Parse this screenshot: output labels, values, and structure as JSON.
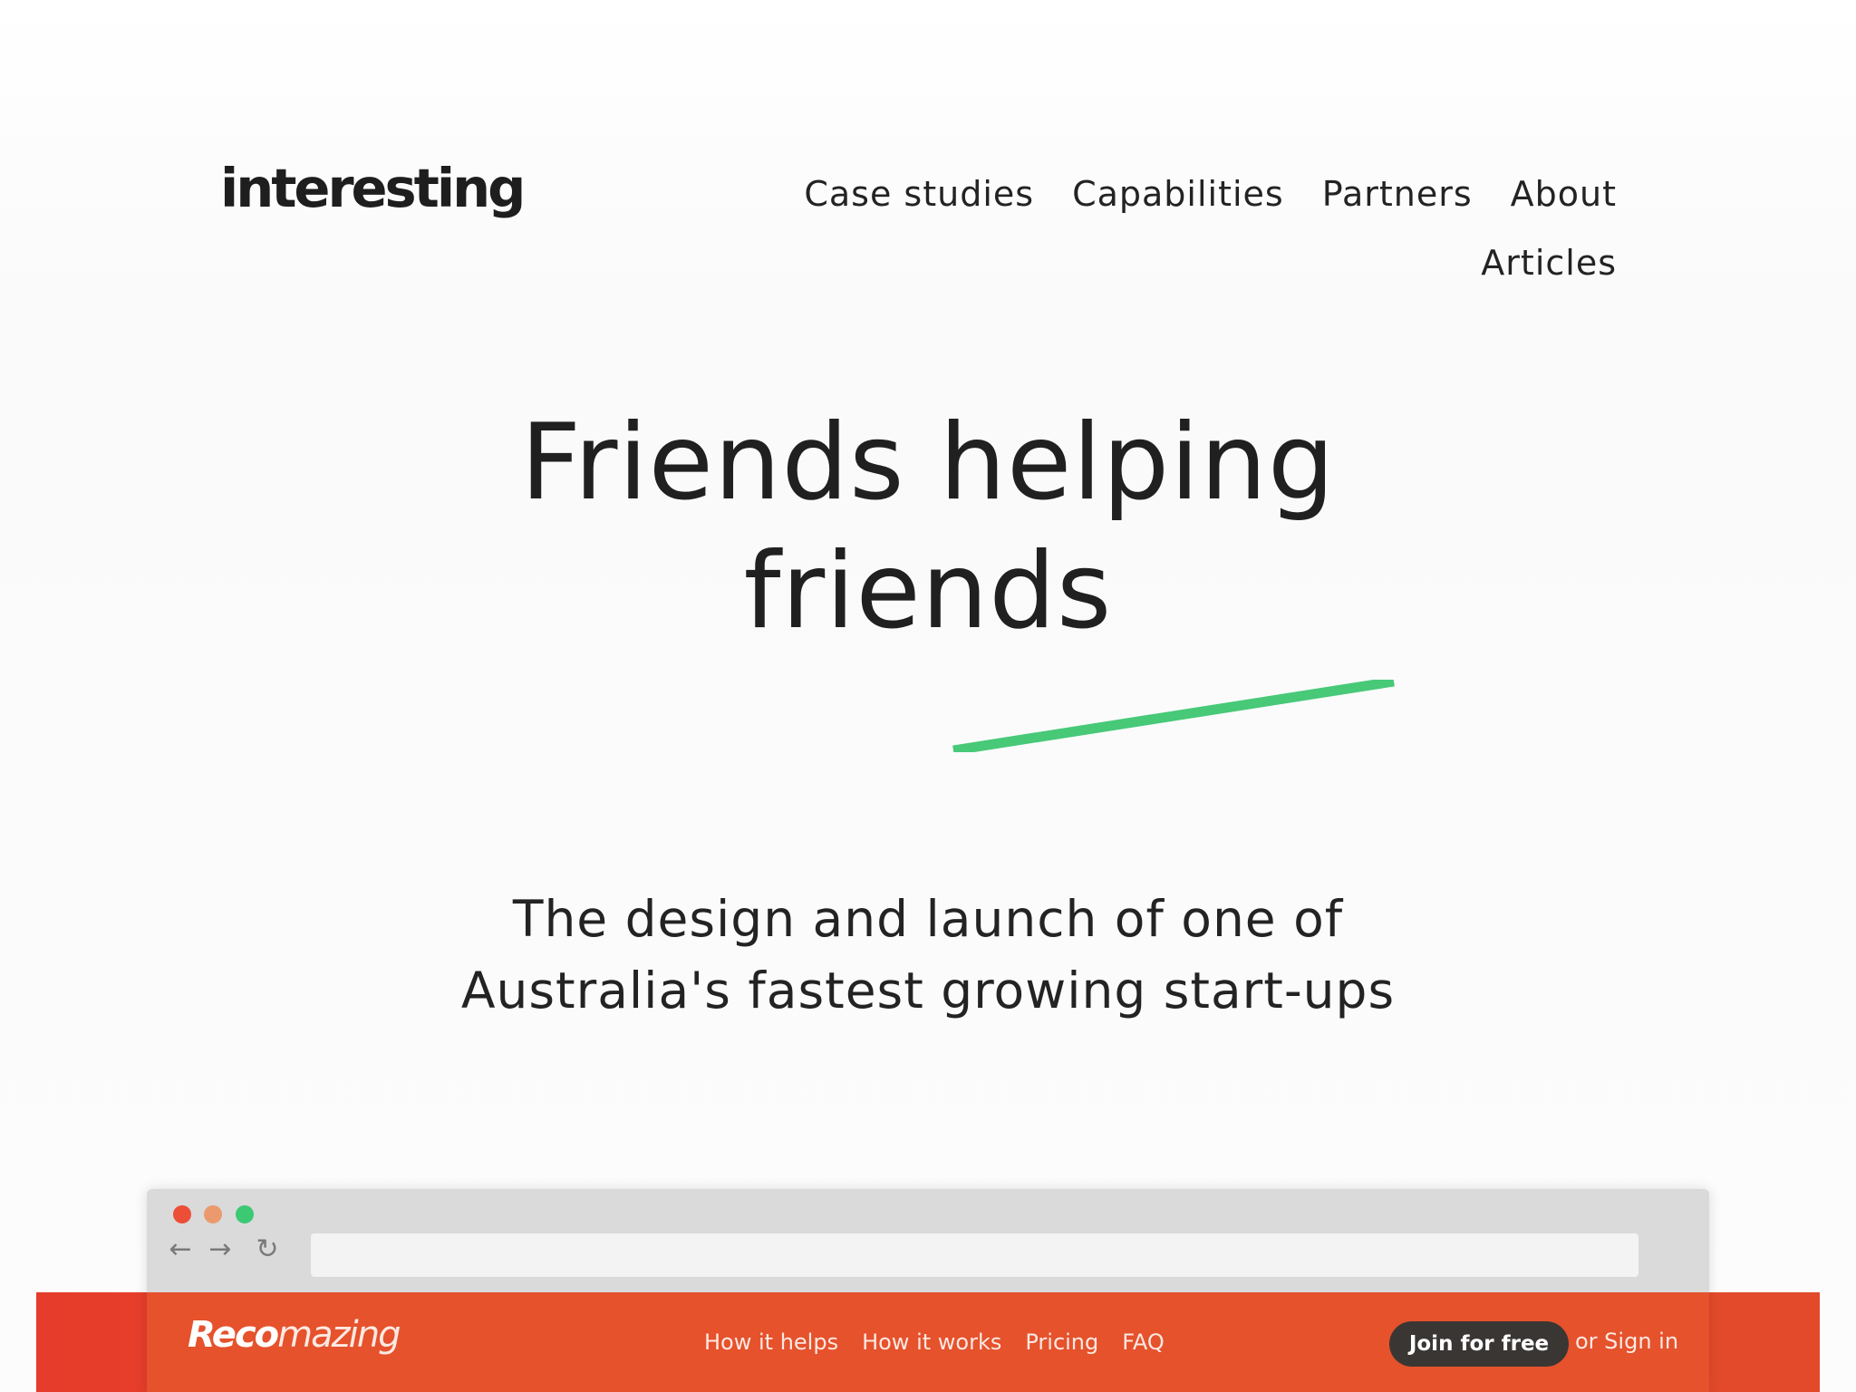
{
  "header": {
    "logo_text": "interesting",
    "nav": [
      {
        "label": "Case studies"
      },
      {
        "label": "Capabilities"
      },
      {
        "label": "Partners"
      },
      {
        "label": "About"
      },
      {
        "label": "Articles"
      }
    ]
  },
  "hero": {
    "title_line1": "Friends helping",
    "title_line2": "friends",
    "subtitle_line1": "The design and launch of one of",
    "subtitle_line2": "Australia's fastest growing start-ups",
    "accent_color": "#47c978"
  },
  "browser_mockup": {
    "window_dots": [
      "close-dot",
      "minimize-dot",
      "maximize-dot"
    ],
    "dot_colors": [
      "#ec4e37",
      "#eb9a6e",
      "#3dc873"
    ],
    "back_icon": "←",
    "forward_icon": "→",
    "reload_icon": "↻",
    "address_value": "",
    "site": {
      "logo_bold": "Reco",
      "logo_light": "mazing",
      "nav": [
        "How it helps",
        "How it works",
        "Pricing",
        "FAQ"
      ],
      "join_label": "Join for free",
      "sign_in_label": "or Sign in",
      "bar_color": "#e5522c"
    }
  }
}
